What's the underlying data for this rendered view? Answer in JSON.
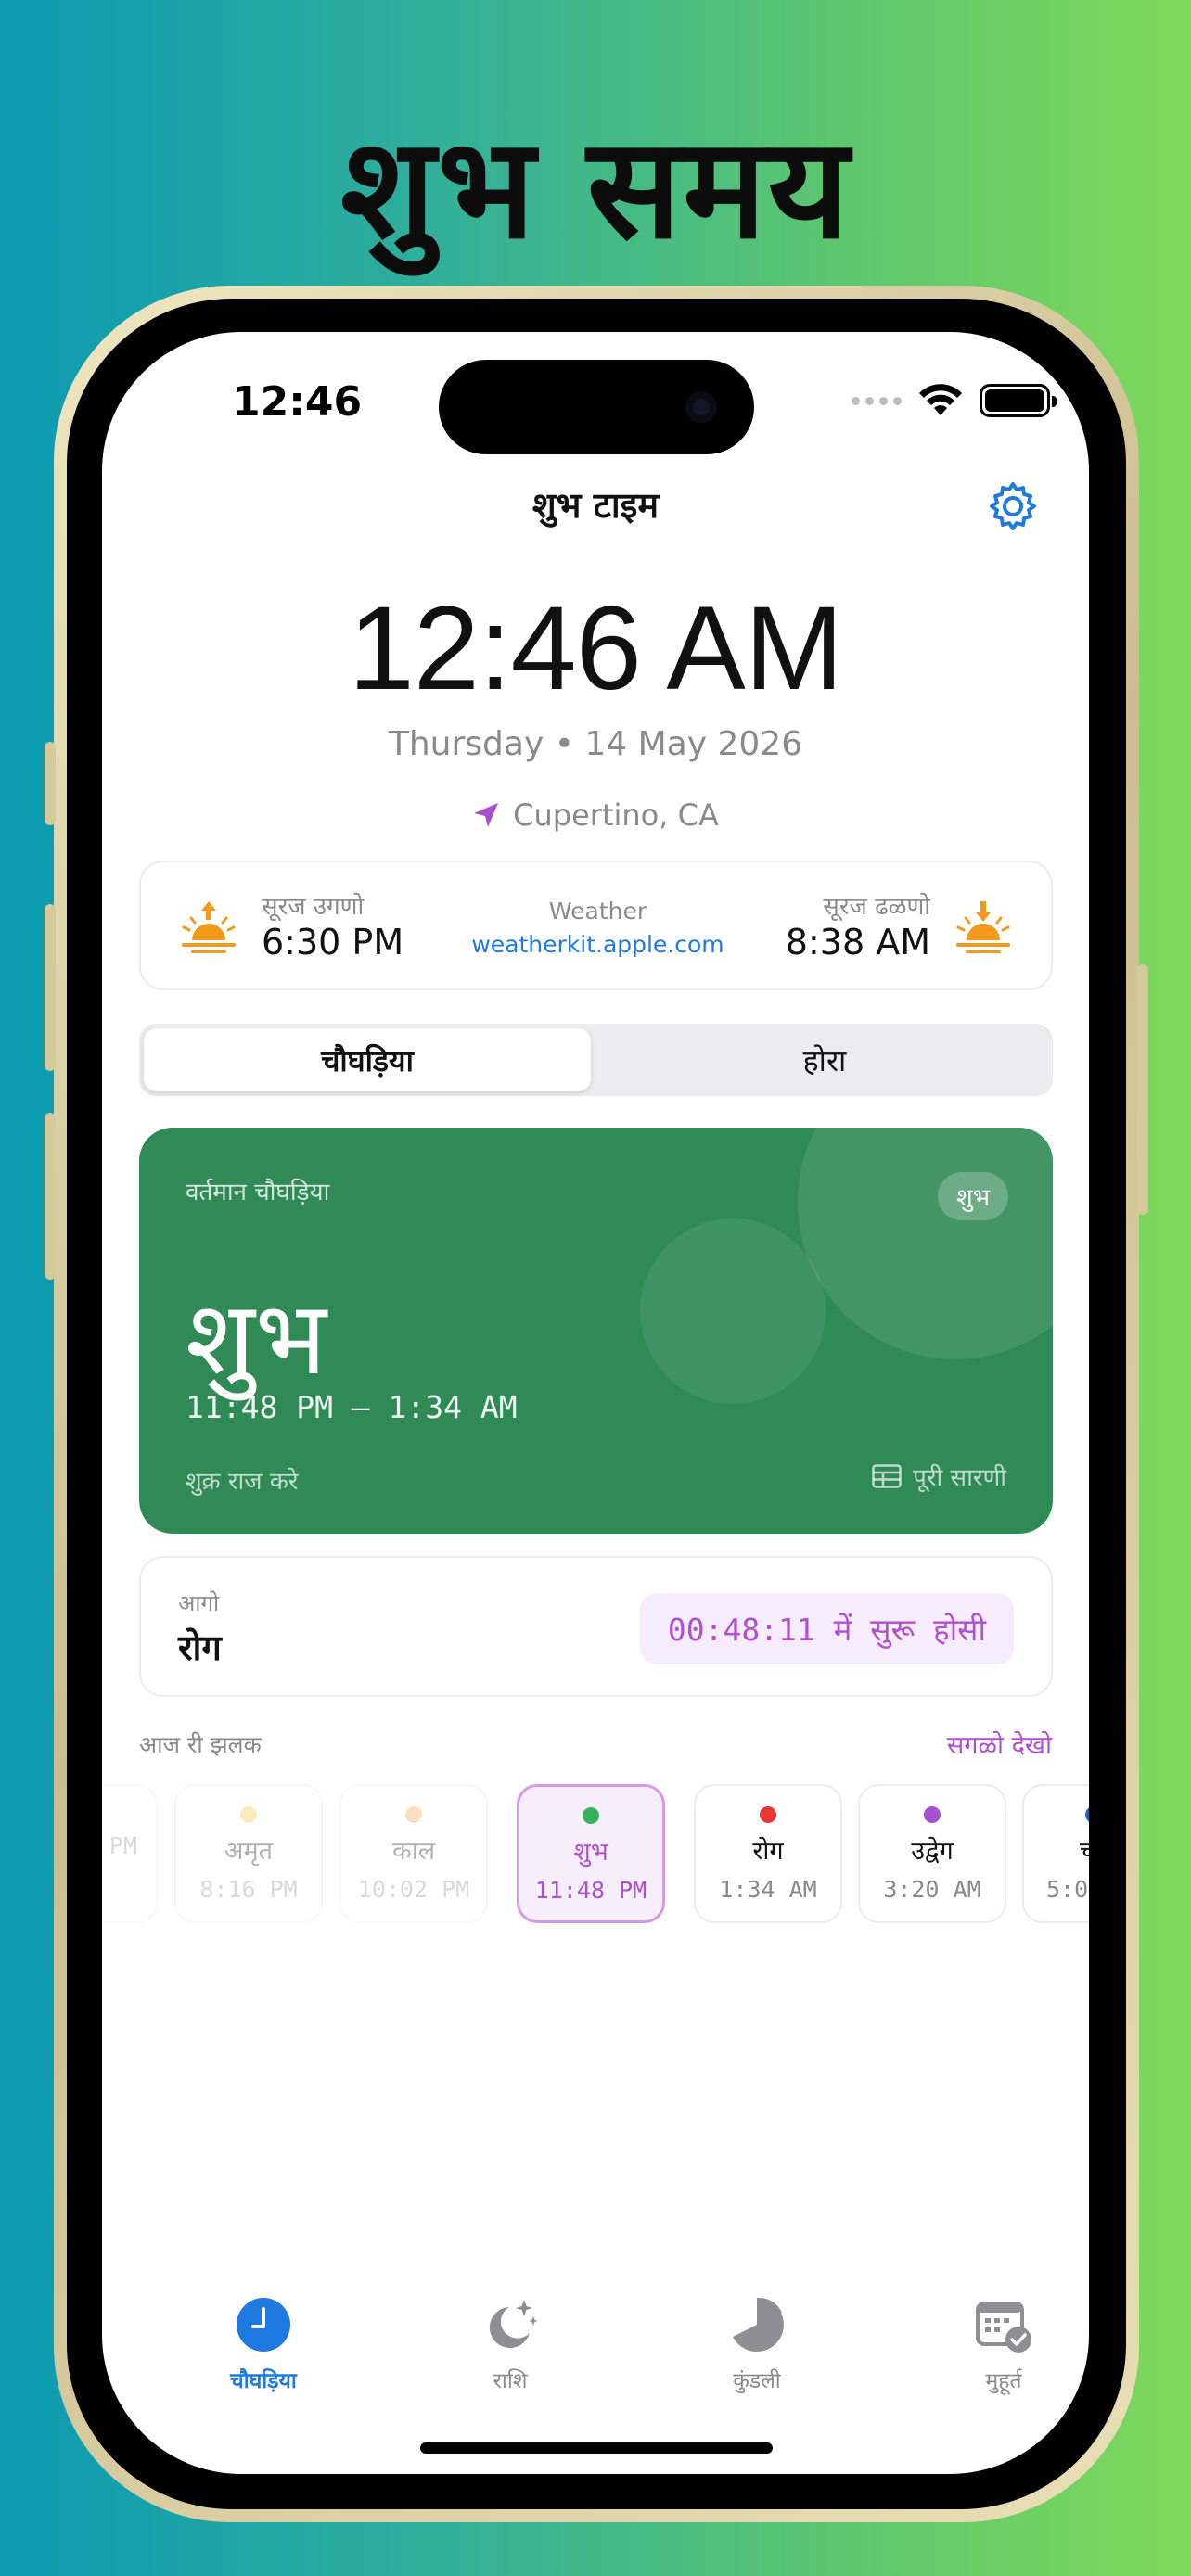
{
  "headline": "शुभ समय",
  "status": {
    "time": "12:46"
  },
  "nav": {
    "title": "शुभ टाइम",
    "settings_icon": "gear-icon"
  },
  "clock": {
    "time": "12:46 AM",
    "date": "Thursday • 14 May 2026",
    "location": "Cupertino, CA"
  },
  "sun": {
    "sunrise_label": "सूरज उगणो",
    "sunrise_time": "6:30 PM",
    "sunset_label": "सूरज ढळणो",
    "sunset_time": "8:38 AM",
    "weather_label": "Weather",
    "weather_link": "weatherkit.apple.com"
  },
  "segment": {
    "tabs": [
      "चौघड़िया",
      "होरा"
    ],
    "selected": "चौघड़िया"
  },
  "current": {
    "label": "वर्तमान चौघड़िया",
    "badge": "शुभ",
    "name": "शुभ",
    "range": "11:48 PM – 1:34 AM",
    "ruler": "शुक्र राज करे",
    "table_link": "पूरी सारणी",
    "color": "#2f8a55"
  },
  "next": {
    "label": "आगो",
    "name": "रोग",
    "countdown": "00:48:11 में सुरू होसी"
  },
  "today": {
    "title": "आज री झलक",
    "see_all": "सगळो देखो",
    "tiles": [
      {
        "name": "",
        "time": "PM",
        "dot": "#ffffff",
        "state": "past"
      },
      {
        "name": "अमृत",
        "time": "8:16 PM",
        "dot": "#f3c230",
        "state": "past"
      },
      {
        "name": "काल",
        "time": "10:02 PM",
        "dot": "#f2a23a",
        "state": "past"
      },
      {
        "name": "शुभ",
        "time": "11:48 PM",
        "dot": "#34b35a",
        "state": "current"
      },
      {
        "name": "रोग",
        "time": "1:34 AM",
        "dot": "#e53935",
        "state": "upcoming"
      },
      {
        "name": "उद्वेग",
        "time": "3:20 AM",
        "dot": "#a64fd0",
        "state": "upcoming"
      },
      {
        "name": "च",
        "time": "5:0",
        "dot": "#1f5fcf",
        "state": "upcoming"
      }
    ]
  },
  "tabbar": {
    "items": [
      {
        "label": "चौघड़िया",
        "icon": "clock-icon",
        "active": true
      },
      {
        "label": "राशि",
        "icon": "moon-stars-icon",
        "active": false
      },
      {
        "label": "कुंडली",
        "icon": "pie-chart-icon",
        "active": false
      },
      {
        "label": "मुहूर्त",
        "icon": "calendar-check-icon",
        "active": false
      }
    ]
  },
  "colors": {
    "accent": "#1f7ae0",
    "purple": "#b04fd0",
    "sun": "#f39a1c"
  }
}
